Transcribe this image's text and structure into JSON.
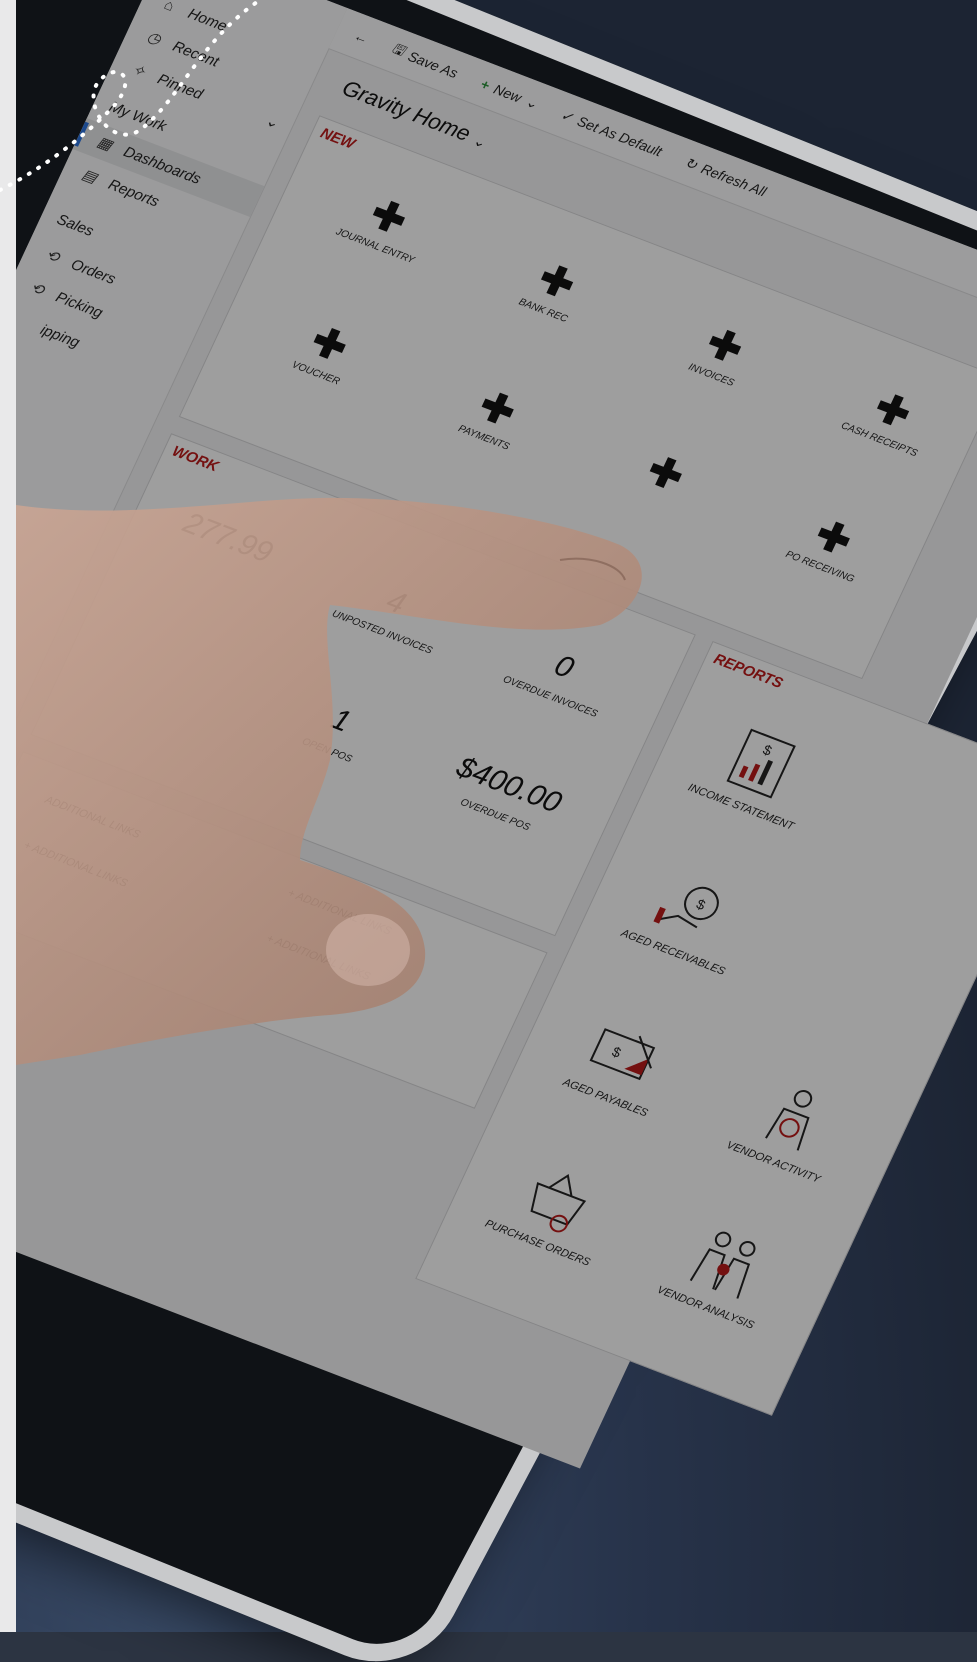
{
  "sidebar": {
    "items": [
      {
        "label": "Home",
        "icon": "home-icon"
      },
      {
        "label": "Recent",
        "icon": "clock-icon"
      },
      {
        "label": "Pinned",
        "icon": "pin-icon"
      },
      {
        "label": "My Work"
      },
      {
        "label": "Dashboards",
        "icon": "dashboard-icon"
      },
      {
        "label": "Reports",
        "icon": "report-icon"
      },
      {
        "label": "Sales"
      },
      {
        "label": "Orders",
        "icon": "orders-icon"
      },
      {
        "label": "Picking",
        "icon": "picking-icon"
      },
      {
        "label": "ipping"
      }
    ]
  },
  "toolbar": {
    "save_as": "Save As",
    "new": "New",
    "set_as_default": "Set As Default",
    "refresh_all": "Refresh All"
  },
  "page": {
    "title": "Gravity Home"
  },
  "new_panel": {
    "title": "NEW",
    "tiles": [
      "JOURNAL ENTRY",
      "BANK REC",
      "INVOICES",
      "CASH RECEIPTS",
      "VOUCHER",
      "PAYMENTS",
      "PO RECEIVING"
    ]
  },
  "work_panel": {
    "title": "WORK",
    "metrics": [
      {
        "value": "277.99",
        "label": ""
      },
      {
        "value": "4",
        "label": "UNPOSTED INVOICES"
      },
      {
        "value": "0",
        "label": "OVERDUE INVOICES"
      },
      {
        "value": "1",
        "label": "OPEN POS"
      },
      {
        "value": "$400.00",
        "label": "OVERDUE POS"
      }
    ]
  },
  "links_panel": {
    "links": [
      "ADDITIONAL LINKS",
      "+ ADDITIONAL LINKS",
      "+ ADDITIONAL LINKS",
      "+ ADDITIONAL LINKS"
    ]
  },
  "reports_panel": {
    "title": "REPORTS",
    "items": [
      {
        "label": "INCOME STATEMENT"
      },
      {
        "label": "AGED RECEIVABLES"
      },
      {
        "label": "AGED PAYABLES"
      },
      {
        "label": "VENDOR ACTIVITY"
      },
      {
        "label": "PURCHASE ORDERS"
      },
      {
        "label": "VENDOR ANALYSIS"
      }
    ]
  },
  "colors": {
    "accent": "#b01818",
    "active_bar": "#2a6fd6"
  }
}
